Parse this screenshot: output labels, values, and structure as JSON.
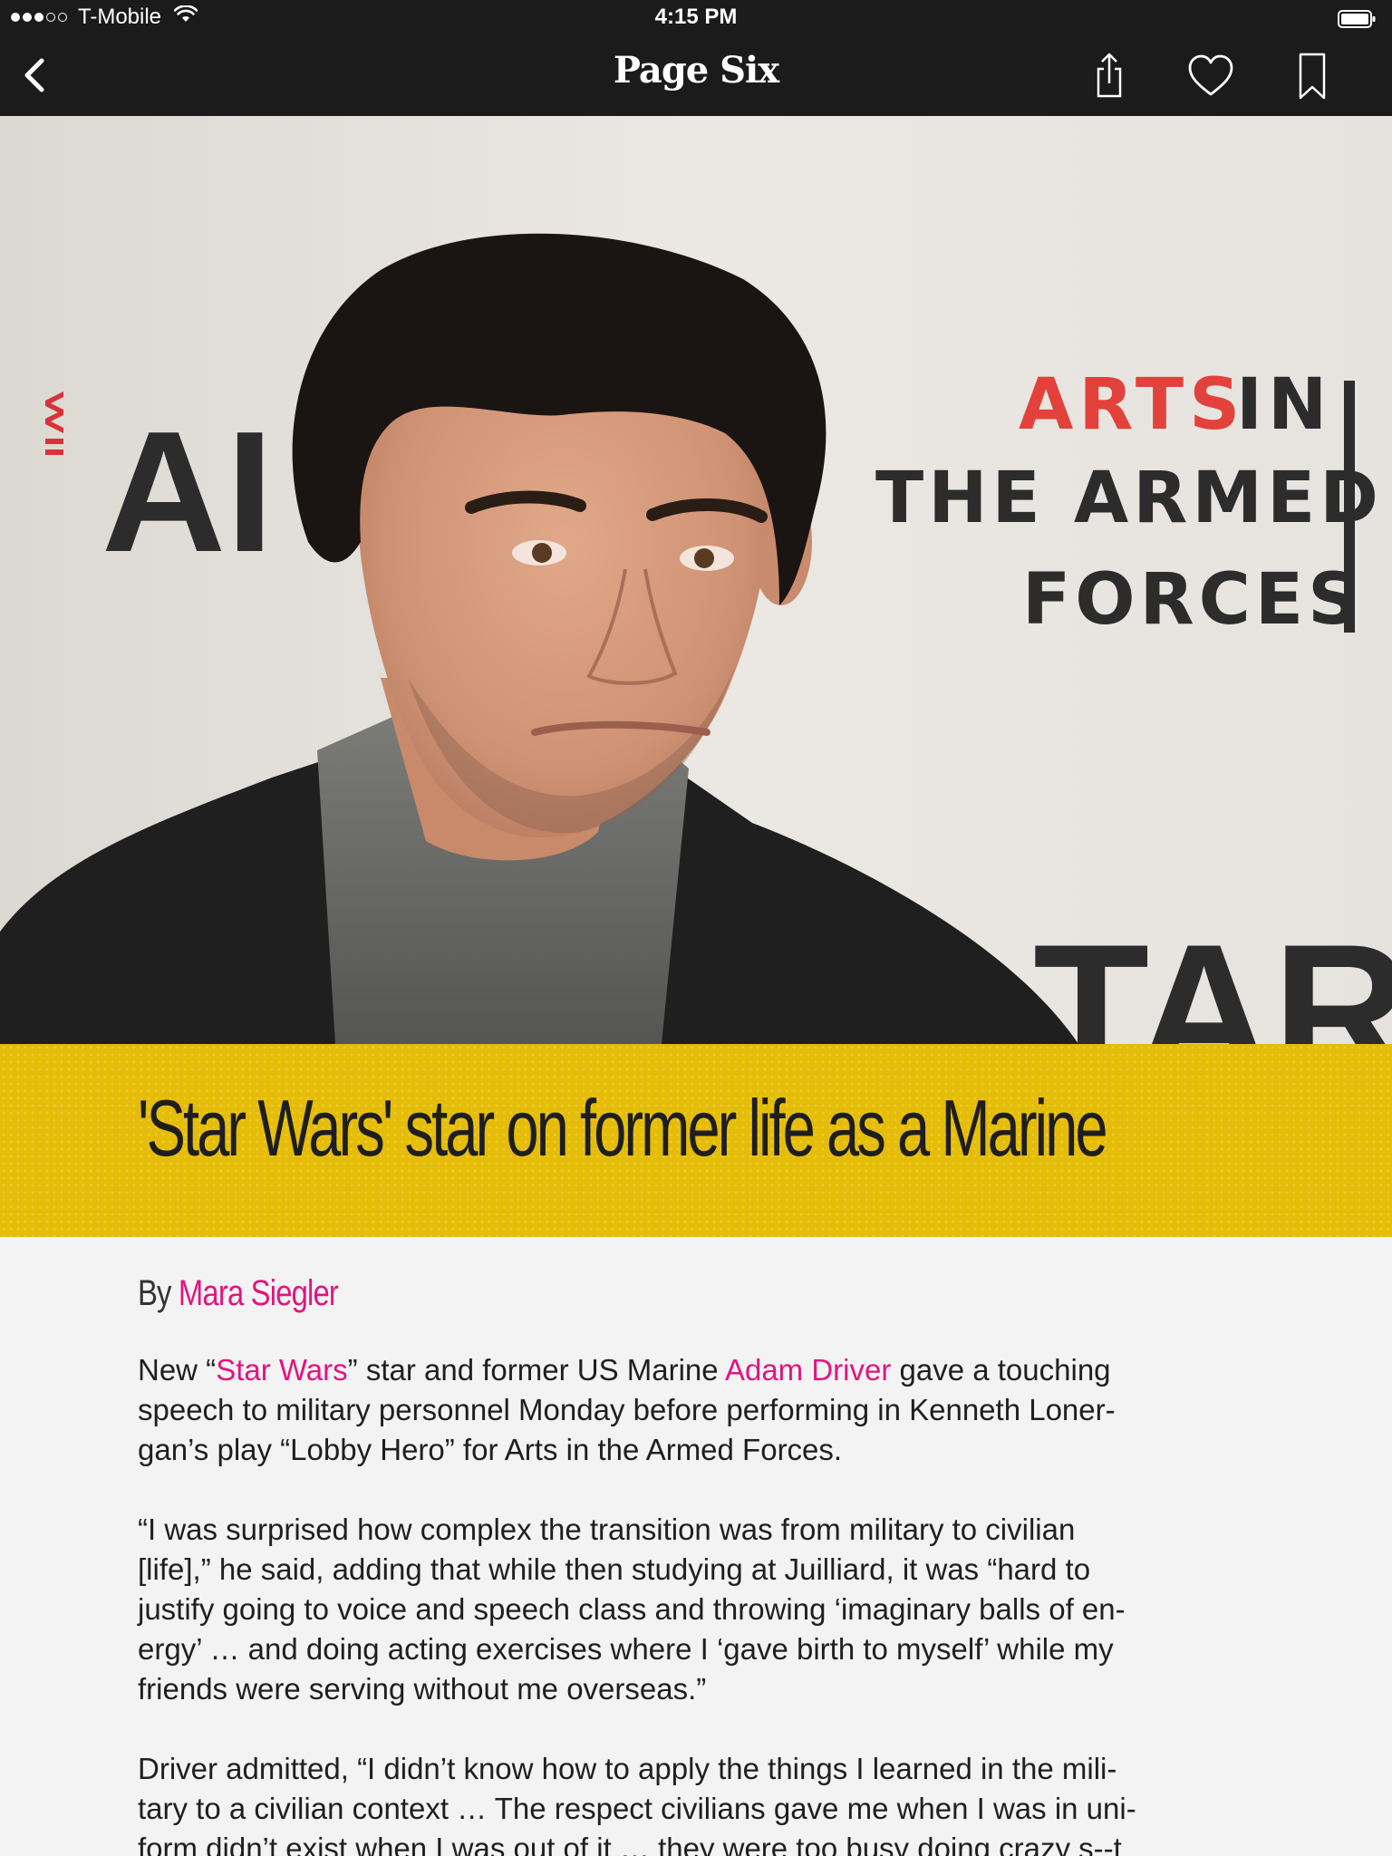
{
  "status_bar": {
    "carrier": "T-Mobile",
    "time": "4:15 PM",
    "signal_bars_filled": 3,
    "signal_bars_total": 5
  },
  "nav": {
    "title": "Page Six",
    "back_icon": "chevron-left-icon",
    "share_icon": "share-icon",
    "like_icon": "heart-icon",
    "bookmark_icon": "bookmark-icon"
  },
  "hero": {
    "backdrop_lines": [
      "ARTS",
      "IN",
      "THE ARMED",
      "FORCES"
    ],
    "backdrop_left_text": "AI",
    "backdrop_bottom_text": "TAR"
  },
  "article": {
    "headline": "'Star Wars' star on former life as a Marine",
    "byline_prefix": "By ",
    "author": "Mara Siegler",
    "p1": {
      "t1": "New “",
      "link1": "Star Wars",
      "t2": "” star and former US Marine ",
      "link2": "Adam Driver",
      "t3": " gave a touching",
      "line2": "speech to military personnel Monday before performing in Kenneth Loner-",
      "line3": "gan’s play “Lobby Hero” for Arts in the Armed Forces."
    },
    "p2": {
      "line1": "“I was surprised how complex the transition was from military to civilian",
      "line2": "[life],” he said, adding that while then studying at Juilliard, it was “hard to",
      "line3": "justify going to voice and speech class and throwing ‘imaginary balls of en-",
      "line4": "ergy’ … and doing acting exercises where I ‘gave birth to myself’ while my",
      "line5": "friends were serving without me overseas.”"
    },
    "p3": {
      "line1": "Driver admitted, “I didn’t know how to apply the things I learned in the mili-",
      "line2": "tary to a civilian context … The respect civilians gave me when I was in uni-",
      "line3": "form didn’t exist when I was out of it … they were too busy doing crazy s--t"
    }
  },
  "colors": {
    "nav_background": "#1b1b1b",
    "headline_band": "#e5bd08",
    "link": "#e0157f",
    "page_background": "#f3f3f3"
  }
}
